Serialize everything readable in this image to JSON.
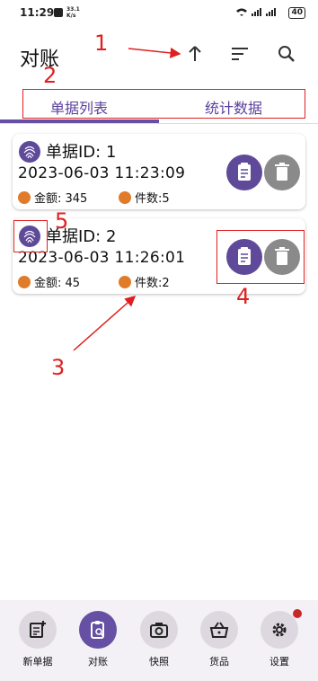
{
  "status": {
    "time": "11:29",
    "speed": "33.1\nK/s",
    "battery": "40"
  },
  "appbar": {
    "title": "对账"
  },
  "tabs": [
    {
      "label": "单据列表"
    },
    {
      "label": "统计数据"
    }
  ],
  "records": [
    {
      "id_label": "单据ID: 1",
      "timestamp": "2023-06-03 11:23:09",
      "amount_label": "金额: 345",
      "count_label": "件数:5"
    },
    {
      "id_label": "单据ID: 2",
      "timestamp": "2023-06-03 11:26:01",
      "amount_label": "金额: 45",
      "count_label": "件数:2"
    }
  ],
  "annotations": [
    "1",
    "2",
    "3",
    "4",
    "5"
  ],
  "nav": [
    {
      "label": "新单据",
      "icon": "new-doc-icon"
    },
    {
      "label": "对账",
      "icon": "reconcile-icon"
    },
    {
      "label": "快照",
      "icon": "camera-icon"
    },
    {
      "label": "货品",
      "icon": "basket-icon"
    },
    {
      "label": "设置",
      "icon": "gear-icon"
    }
  ]
}
